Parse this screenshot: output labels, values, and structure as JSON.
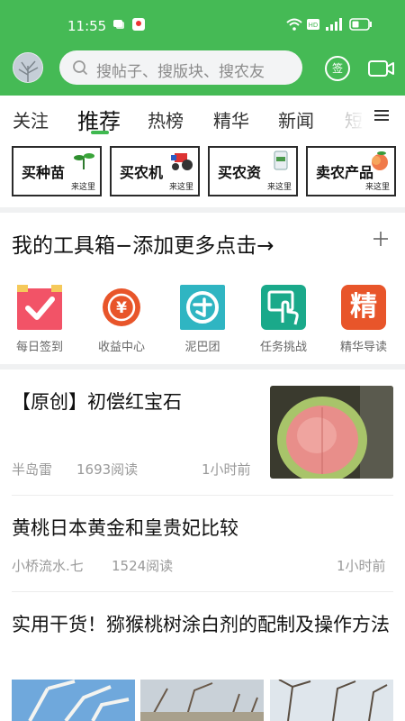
{
  "status_bar": {
    "time": "11:55"
  },
  "header": {
    "search_placeholder": "搜帖子、搜版块、搜农友",
    "sign_label": "签"
  },
  "tabs": [
    {
      "label": "关注"
    },
    {
      "label": "推荐"
    },
    {
      "label": "热榜"
    },
    {
      "label": "精华"
    },
    {
      "label": "新闻"
    },
    {
      "label": "短"
    }
  ],
  "active_tab": "推荐",
  "shortcuts": [
    {
      "label": "买种苗",
      "sub": "来这里"
    },
    {
      "label": "买农机",
      "sub": "来这里"
    },
    {
      "label": "买农资",
      "sub": "来这里"
    },
    {
      "label": "卖农产品",
      "sub": "来这里"
    }
  ],
  "toolbox": {
    "title": "我的工具箱−添加更多点击→",
    "tools": [
      {
        "label": "每日签到",
        "icon": "checkin-icon"
      },
      {
        "label": "收益中心",
        "icon": "yen-icon"
      },
      {
        "label": "泥巴团",
        "icon": "niba-icon"
      },
      {
        "label": "任务挑战",
        "icon": "task-icon"
      },
      {
        "label": "精华导读",
        "icon": "jing-icon",
        "glyph": "精"
      }
    ]
  },
  "feed": [
    {
      "title": "【原创】初偿红宝石",
      "author": "半岛雷",
      "reads": "1693阅读",
      "time": "1小时前"
    },
    {
      "title": "黄桃日本黄金和皇贵妃比较",
      "author": "小桥流水.七",
      "reads": "1524阅读",
      "time": "1小时前"
    },
    {
      "title": "实用干货！猕猴桃树涂白剂的配制及操作方法"
    }
  ],
  "colors": {
    "brand_green": "#45ba55",
    "tab_indicator": "#3fb950"
  }
}
